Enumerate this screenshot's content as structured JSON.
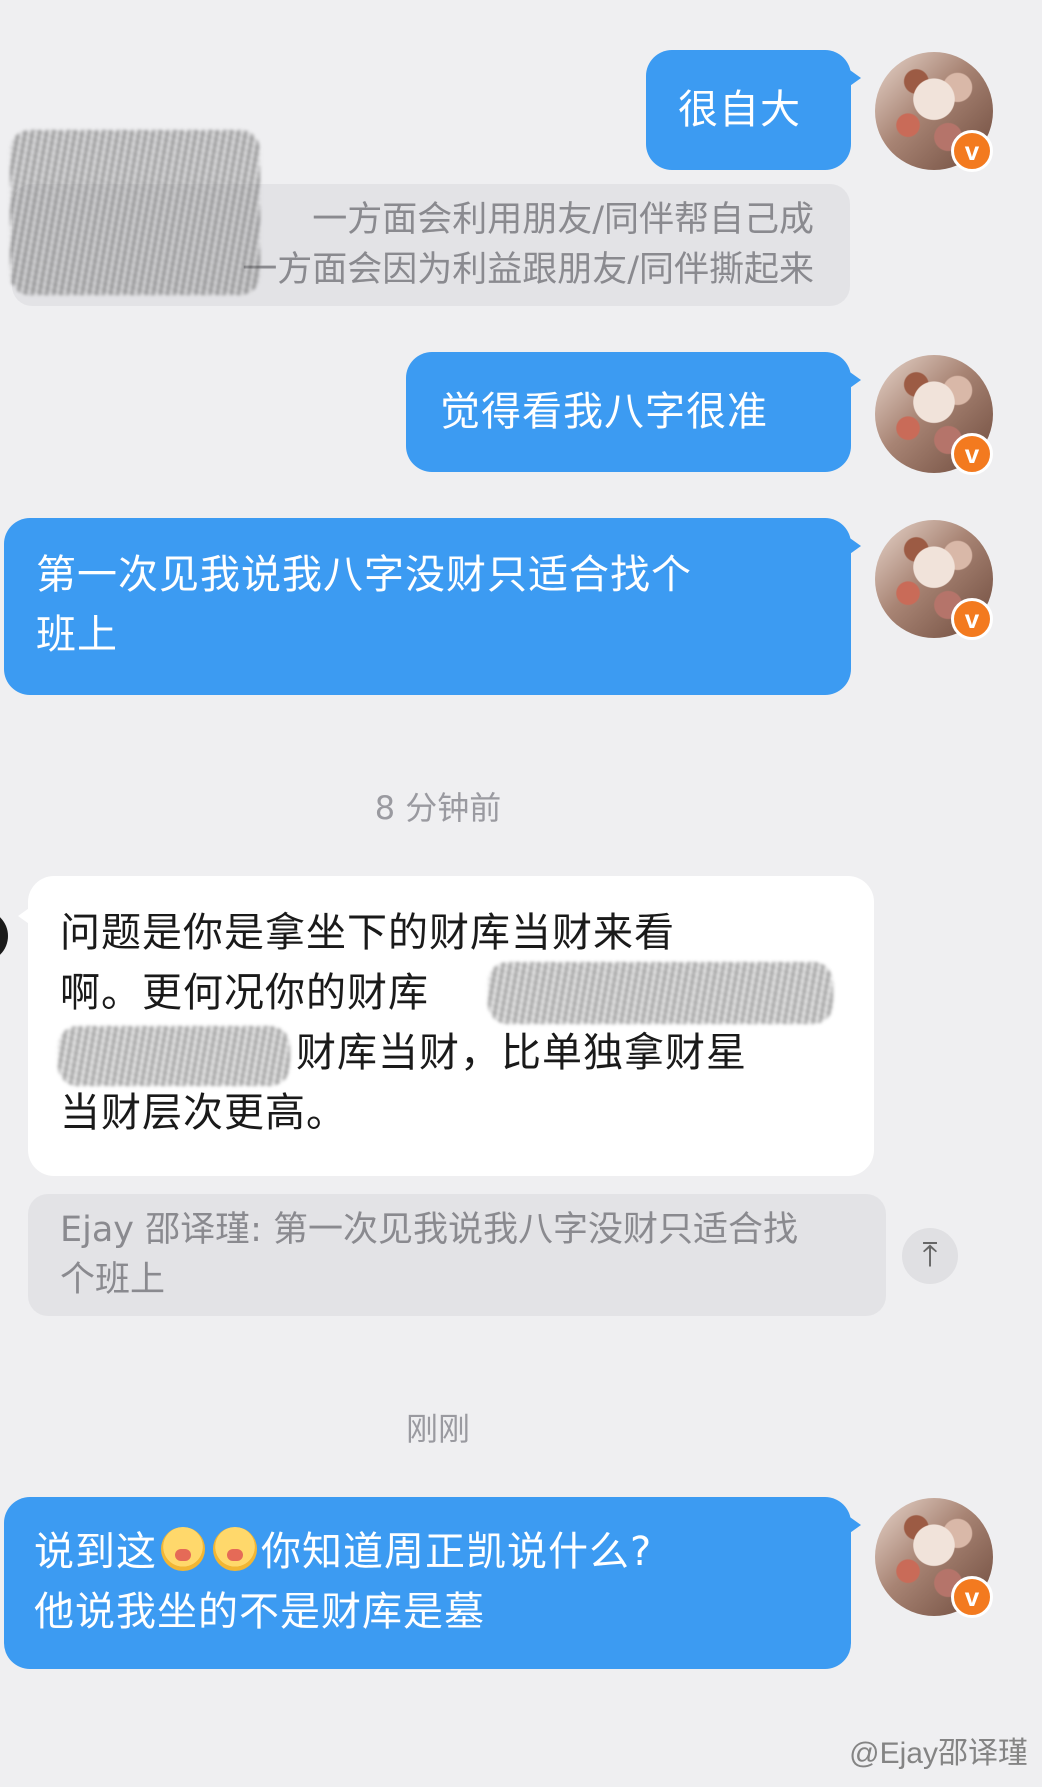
{
  "messages": [
    {
      "id": "m1",
      "text": "很自大"
    },
    {
      "id": "q1",
      "line1": "一方面会利用朋友/同伴帮自己成",
      "line2": "一方面会因为利益跟朋友/同伴撕起来"
    },
    {
      "id": "m2",
      "text": "觉得看我八字很准"
    },
    {
      "id": "m3",
      "line1": "第一次见我说我八字没财只适合找个",
      "line2": "班上"
    },
    {
      "id": "m4",
      "line1": "问题是你是拿坐下的财库当财来看",
      "line2": "啊。更何况你的财库",
      "line3": "财库当财，比单独拿财星",
      "line4": "当财层次更高。"
    },
    {
      "id": "q2",
      "line1": "Ejay 邵译瑾: 第一次见我说我八字没财只适合找",
      "line2": "个班上"
    },
    {
      "id": "m5",
      "line1_a": "说到这",
      "line1_b": "你知道周正凯说什么?",
      "line2": "他说我坐的不是财库是墓"
    }
  ],
  "timestamps": [
    "8 分钟前",
    "刚刚"
  ],
  "badge_letter": "v",
  "scroll_top_icon": "⤒",
  "watermark": "@Ejay邵译瑾",
  "colors": {
    "outgoing_bubble": "#3c9bf2",
    "incoming_bubble": "#ffffff",
    "background": "#efeff1",
    "quote": "#e3e3e6",
    "badge": "#f37a1f"
  }
}
